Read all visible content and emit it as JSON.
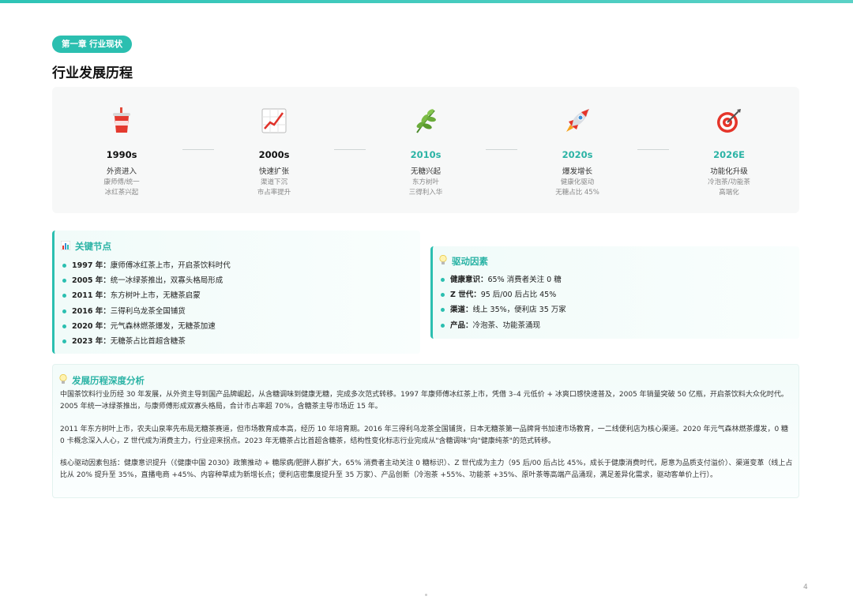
{
  "header": {
    "chapter_badge": "第一章 行业现状",
    "title": "行业发展历程"
  },
  "timeline": [
    {
      "icon": "soda-cup-icon",
      "year": "1990s",
      "name": "外资进入",
      "desc1": "康师傅/统一",
      "desc2": "冰红茶兴起",
      "highlight": false
    },
    {
      "icon": "trend-chart-icon",
      "year": "2000s",
      "name": "快速扩张",
      "desc1": "渠道下沉",
      "desc2": "市占率提升",
      "highlight": false
    },
    {
      "icon": "herb-leaf-icon",
      "year": "2010s",
      "name": "无糖兴起",
      "desc1": "东方树叶",
      "desc2": "三得利入华",
      "highlight": true
    },
    {
      "icon": "rocket-icon",
      "year": "2020s",
      "name": "爆发增长",
      "desc1": "健康化驱动",
      "desc2": "无糖占比 45%",
      "highlight": true
    },
    {
      "icon": "target-icon",
      "year": "2026E",
      "name": "功能化升级",
      "desc1": "冷泡茶/功能茶",
      "desc2": "高端化",
      "highlight": true
    }
  ],
  "key_nodes": {
    "title": "关键节点",
    "icon": "bar-chart-icon",
    "items": [
      {
        "label": "1997 年：",
        "text": "康师傅冰红茶上市，开启茶饮料时代"
      },
      {
        "label": "2005 年：",
        "text": "统一冰绿茶推出，双寡头格局形成"
      },
      {
        "label": "2011 年：",
        "text": "东方树叶上市，无糖茶启蒙"
      },
      {
        "label": "2016 年：",
        "text": "三得利乌龙茶全国铺货"
      },
      {
        "label": "2020 年：",
        "text": "元气森林燃茶爆发，无糖茶加速"
      },
      {
        "label": "2023 年：",
        "text": "无糖茶占比首超含糖茶"
      }
    ]
  },
  "drivers": {
    "title": "驱动因素",
    "icon": "lightbulb-icon",
    "items": [
      {
        "label": "健康意识：",
        "text": "65% 消费者关注 0 糖"
      },
      {
        "label": "Z 世代：",
        "text": "95 后/00 后占比 45%"
      },
      {
        "label": "渠道：",
        "text": "线上 35%，便利店 35 万家"
      },
      {
        "label": "产品：",
        "text": "冷泡茶、功能茶涌现"
      }
    ]
  },
  "analysis": {
    "title": "发展历程深度分析",
    "icon": "lightbulb-icon",
    "p1": "中国茶饮料行业历经 30 年发展，从外资主导到国产品牌崛起，从含糖调味到健康无糖，完成多次范式转移。1997 年康师傅冰红茶上市，凭借 3–4 元低价 + 冰爽口感快速普及，2005 年销量突破 50 亿瓶，开启茶饮料大众化时代。2005 年统一冰绿茶推出，与康师傅形成双寡头格局，合计市占率超 70%，含糖茶主导市场近 15 年。",
    "p2": "2011 年东方树叶上市，农夫山泉率先布局无糖茶赛道，但市场教育成本高，经历 10 年培育期。2016 年三得利乌龙茶全国铺货，日本无糖茶第一品牌背书加速市场教育，一二线便利店为核心渠道。2020 年元气森林燃茶爆发，0 糖 0 卡概念深入人心，Z 世代成为消费主力，行业迎来拐点。2023 年无糖茶占比首超含糖茶，结构性变化标志行业完成从\"含糖调味\"向\"健康纯茶\"的范式转移。",
    "p3": "核心驱动因素包括：健康意识提升（《健康中国 2030》政策推动 + 糖尿病/肥胖人群扩大，65% 消费者主动关注 0 糖标识）、Z 世代成为主力（95 后/00 后占比 45%，成长于健康消费时代，愿意为品质支付溢价）、渠道变革（线上占比从 20% 提升至 35%，直播电商 +45%、内容种草成为新增长点；便利店密集度提升至 35 万家）、产品创新（冷泡茶 +55%、功能茶 +35%、原叶茶等高端产品涌现，满足差异化需求，驱动客单价上行）。"
  },
  "footer": {
    "page_number": "4"
  },
  "colors": {
    "accent": "#2bbfb0",
    "accent_text": "#2bb3a5"
  }
}
